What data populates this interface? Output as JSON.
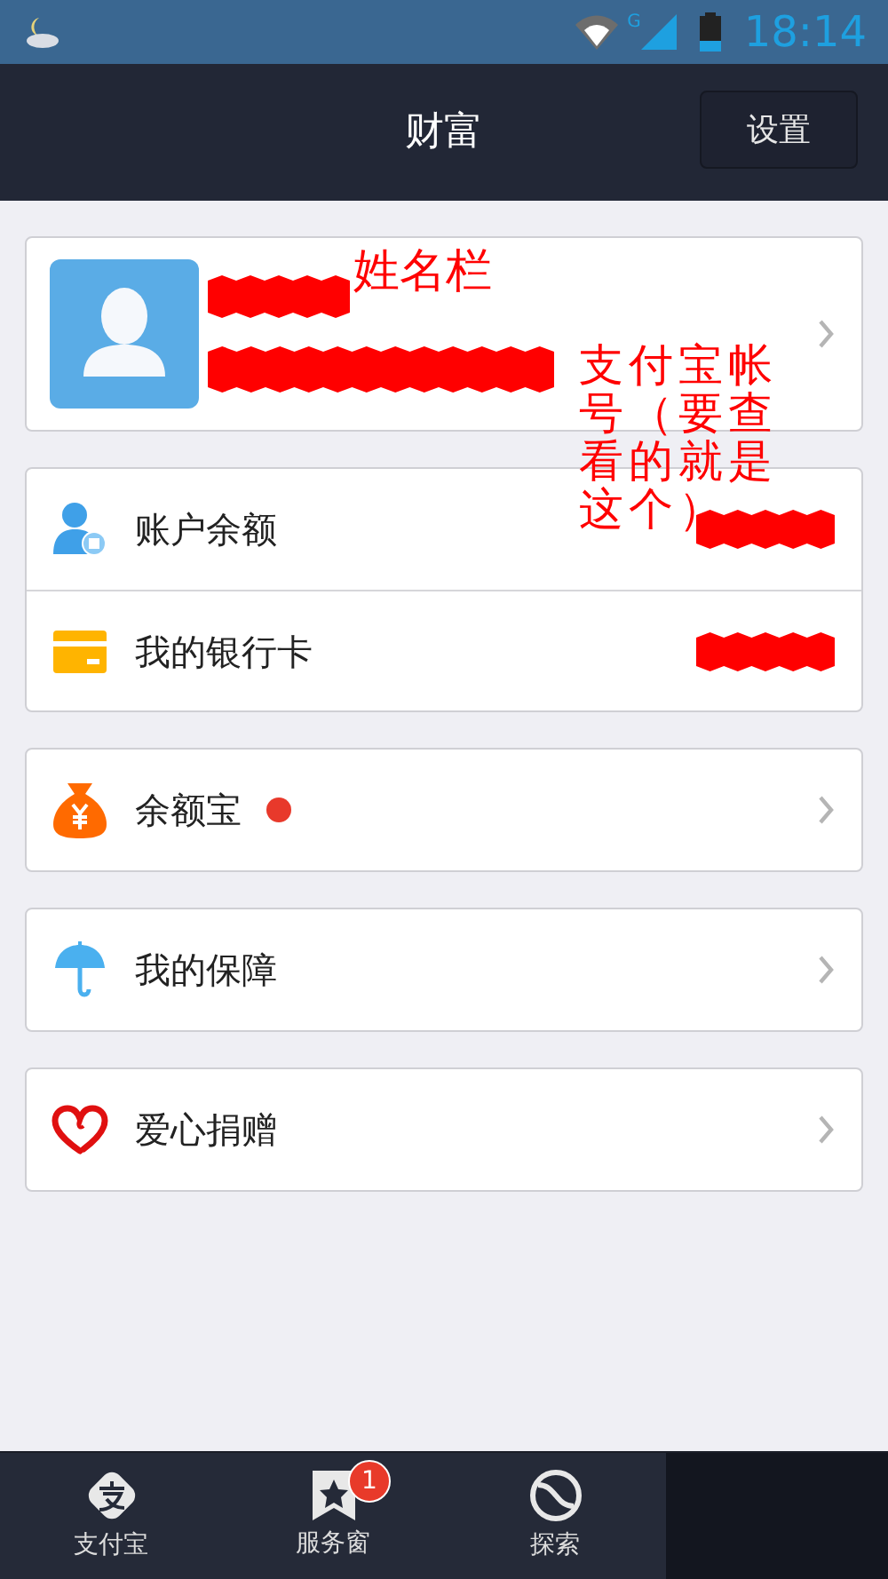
{
  "status_bar": {
    "network": "G",
    "time": "18:14"
  },
  "header": {
    "title": "财富",
    "settings_button": "设置"
  },
  "profile": {
    "chevron": true,
    "name_redacted": true,
    "account_redacted": true
  },
  "groups": [
    {
      "items": [
        {
          "kind": "balance",
          "label": "账户余额",
          "dot": false,
          "value_redacted": true,
          "chevron": false
        },
        {
          "kind": "card",
          "label": "我的银行卡",
          "dot": false,
          "value_redacted": true,
          "chevron": false
        }
      ]
    },
    {
      "items": [
        {
          "kind": "moneybag",
          "label": "余额宝",
          "dot": true,
          "value_redacted": false,
          "chevron": true
        }
      ]
    },
    {
      "items": [
        {
          "kind": "umbrella",
          "label": "我的保障",
          "dot": false,
          "value_redacted": false,
          "chevron": true
        }
      ]
    },
    {
      "items": [
        {
          "kind": "heart",
          "label": "爱心捐赠",
          "dot": false,
          "value_redacted": false,
          "chevron": true
        }
      ]
    }
  ],
  "annotations": [
    {
      "text": "姓名栏"
    },
    {
      "text": "支付宝帐号（要查看的就是这个）"
    }
  ],
  "tab_bar": [
    {
      "kind": "pay",
      "label": "支付宝",
      "selected": false
    },
    {
      "kind": "service",
      "label": "服务窗",
      "badge": "1",
      "selected": false
    },
    {
      "kind": "explore",
      "label": "探索",
      "selected": false
    },
    {
      "kind": "hidden",
      "selected": true
    }
  ]
}
